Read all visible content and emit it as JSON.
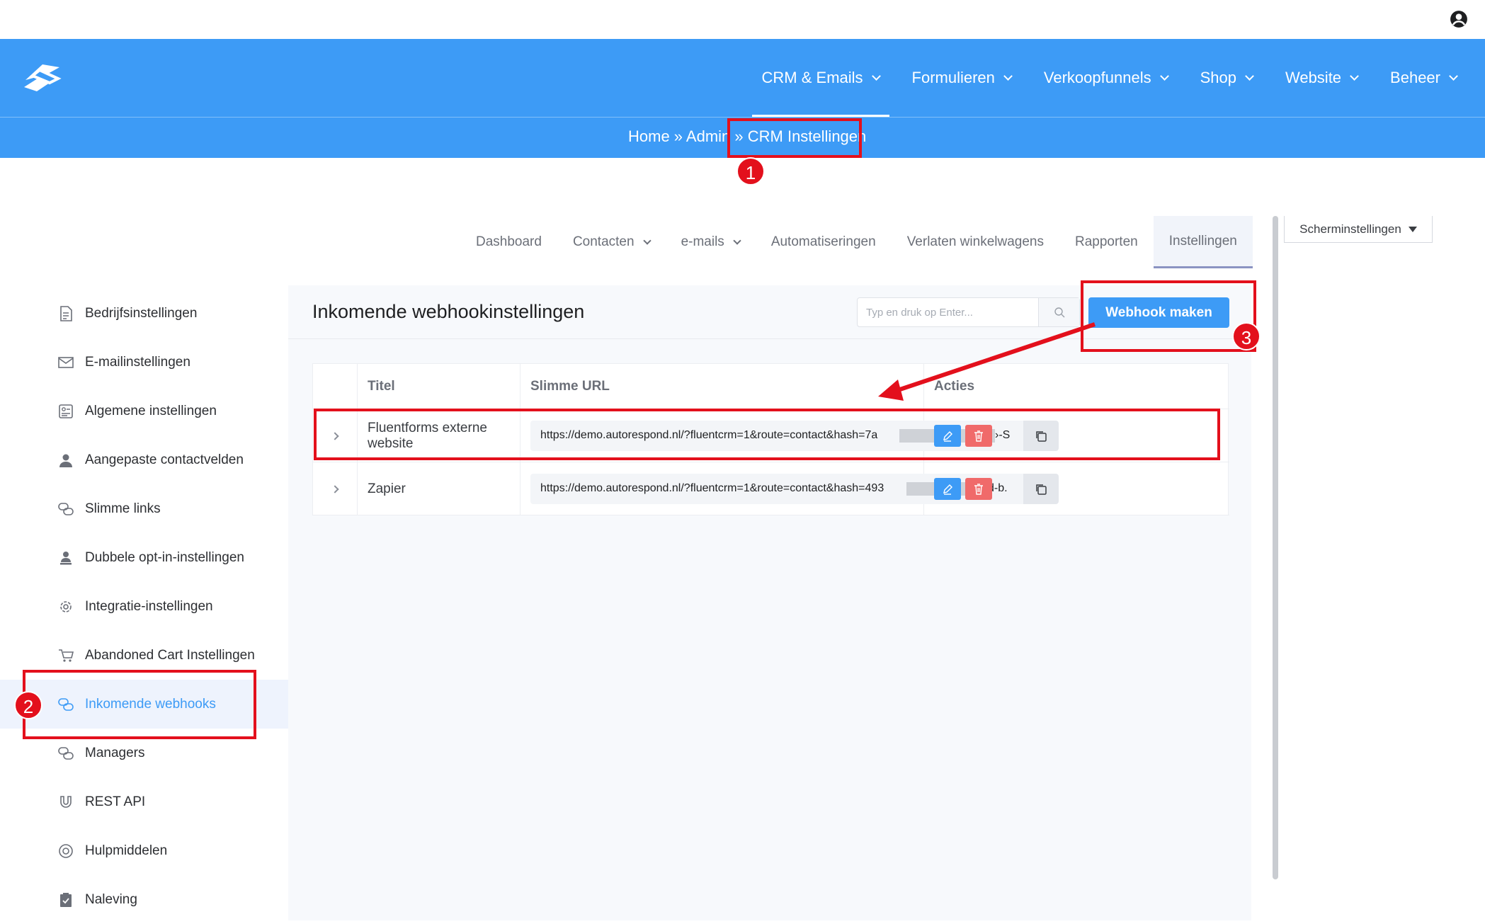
{
  "header": {
    "nav": [
      {
        "label": "CRM & Emails",
        "active": true
      },
      {
        "label": "Formulieren",
        "active": false
      },
      {
        "label": "Verkoopfunnels",
        "active": false
      },
      {
        "label": "Shop",
        "active": false
      },
      {
        "label": "Website",
        "active": false
      },
      {
        "label": "Beheer",
        "active": false
      }
    ],
    "icons": {
      "logo": "app-logo",
      "user": "user-circle-icon"
    }
  },
  "breadcrumb": {
    "text": "Home » Admin » CRM Instellingen"
  },
  "annotations": {
    "badge1": "1",
    "badge2": "2",
    "badge3": "3",
    "color": "#e3101c"
  },
  "tabs": [
    {
      "label": "Dashboard",
      "dropdown": false,
      "active": false
    },
    {
      "label": "Contacten",
      "dropdown": true,
      "active": false
    },
    {
      "label": "e-mails",
      "dropdown": true,
      "active": false
    },
    {
      "label": "Automatiseringen",
      "dropdown": false,
      "active": false
    },
    {
      "label": "Verlaten winkelwagens",
      "dropdown": false,
      "active": false
    },
    {
      "label": "Rapporten",
      "dropdown": false,
      "active": false
    },
    {
      "label": "Instellingen",
      "dropdown": false,
      "active": true
    }
  ],
  "screen_settings": {
    "label": "Scherminstellingen"
  },
  "sidebar": {
    "items": [
      {
        "label": "Bedrijfsinstellingen",
        "icon": "document-icon"
      },
      {
        "label": "E-mailinstellingen",
        "icon": "envelope-icon"
      },
      {
        "label": "Algemene instellingen",
        "icon": "settings-card-icon"
      },
      {
        "label": "Aangepaste contactvelden",
        "icon": "person-icon"
      },
      {
        "label": "Slimme links",
        "icon": "link-icon"
      },
      {
        "label": "Dubbele opt-in-instellingen",
        "icon": "user-stamp-icon"
      },
      {
        "label": "Integratie-instellingen",
        "icon": "gear-icon"
      },
      {
        "label": "Abandoned Cart Instellingen",
        "icon": "cart-icon"
      },
      {
        "label": "Inkomende webhooks",
        "icon": "webhook-icon",
        "active": true
      },
      {
        "label": "Managers",
        "icon": "link-icon"
      },
      {
        "label": "REST API",
        "icon": "magnet-icon"
      },
      {
        "label": "Hulpmiddelen",
        "icon": "lifebuoy-icon"
      },
      {
        "label": "Naleving",
        "icon": "clipboard-icon"
      }
    ]
  },
  "main": {
    "title": "Inkomende webhookinstellingen",
    "search": {
      "placeholder": "Typ en druk op Enter...",
      "value": ""
    },
    "create_button": "Webhook maken",
    "table": {
      "columns": [
        "Titel",
        "Slimme URL",
        "Acties"
      ],
      "rows": [
        {
          "title": "Fluentforms externe website",
          "url": "https://demo.autorespond.nl/?fluentcrm=1&route=contact&hash=7a",
          "url_tail": "›-S"
        },
        {
          "title": "Zapier",
          "url": "https://demo.autorespond.nl/?fluentcrm=1&route=contact&hash=493",
          "url_tail": "d-b."
        }
      ]
    }
  },
  "colors": {
    "accent": "#3d9bf6",
    "danger": "#f06a6a",
    "active_bg": "#eef3fd"
  }
}
